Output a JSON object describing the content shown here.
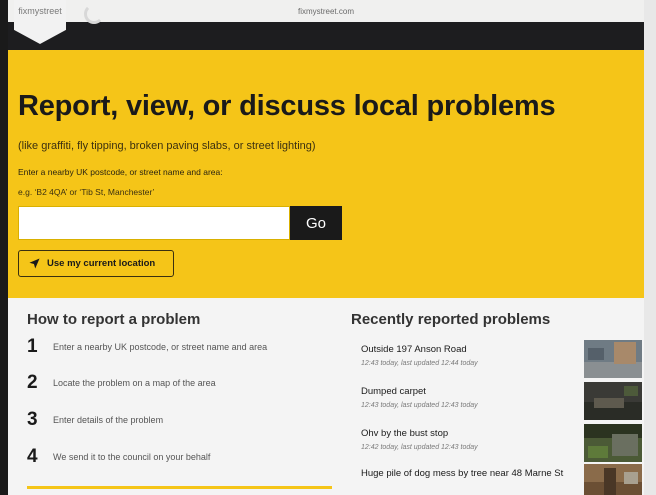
{
  "browser": {
    "url": "fixmystreet.com"
  },
  "header": {
    "logo_text": "fixmystreet"
  },
  "hero": {
    "title": "Report, view, or discuss local problems",
    "subtitle": "(like graffiti, fly tipping, broken paving slabs, or street lighting)",
    "search_label": "Enter a nearby UK postcode, or street name and area:",
    "search_example": "e.g. ‘B2 4QA’ or ‘Tib St, Manchester’",
    "search_value": "",
    "go_label": "Go",
    "location_label": "Use my current location",
    "location_icon": "location-arrow-icon"
  },
  "how_to": {
    "title": "How to report a problem",
    "steps": [
      {
        "number": "1",
        "text": "Enter a nearby UK postcode, or street name and area"
      },
      {
        "number": "2",
        "text": "Locate the problem on a map of the area"
      },
      {
        "number": "3",
        "text": "Enter details of the problem"
      },
      {
        "number": "4",
        "text": "We send it to the council on your behalf"
      }
    ]
  },
  "recent": {
    "title": "Recently reported problems",
    "items": [
      {
        "title": "Outside 197 Anson Road",
        "meta": "12:43 today, last updated 12:44 today"
      },
      {
        "title": "Dumped carpet",
        "meta": "12:43 today, last updated 12:43 today"
      },
      {
        "title": "Ohv by the bust stop",
        "meta": "12:42 today, last updated 12:43 today"
      },
      {
        "title": "Huge pile of dog mess by tree near 48 Marne St",
        "meta": ""
      }
    ]
  },
  "colors": {
    "brand_yellow": "#f5c518",
    "dark": "#1a1a1a"
  }
}
